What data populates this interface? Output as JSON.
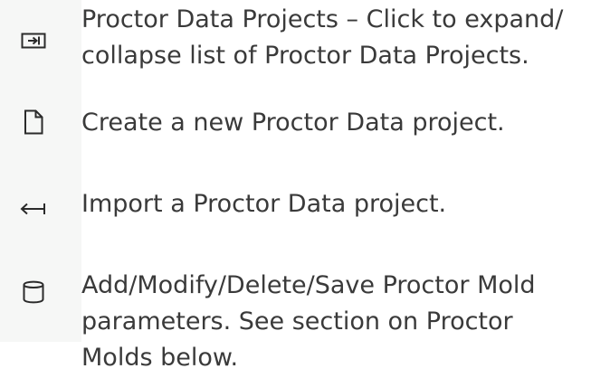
{
  "items": [
    {
      "icon": "expand-collapse-icon",
      "lines": [
        "Proctor Data Projects – Click to expand/",
        "collapse list of Proctor Data Projects."
      ]
    },
    {
      "icon": "new-file-icon",
      "lines": [
        "Create a new Proctor Data project."
      ]
    },
    {
      "icon": "import-arrow-icon",
      "lines": [
        "Import a Proctor Data project."
      ]
    },
    {
      "icon": "database-cylinder-icon",
      "lines": [
        "Add/Modify/Delete/Save Proctor Mold",
        "parameters. See section on Proctor",
        "Molds below."
      ]
    }
  ]
}
